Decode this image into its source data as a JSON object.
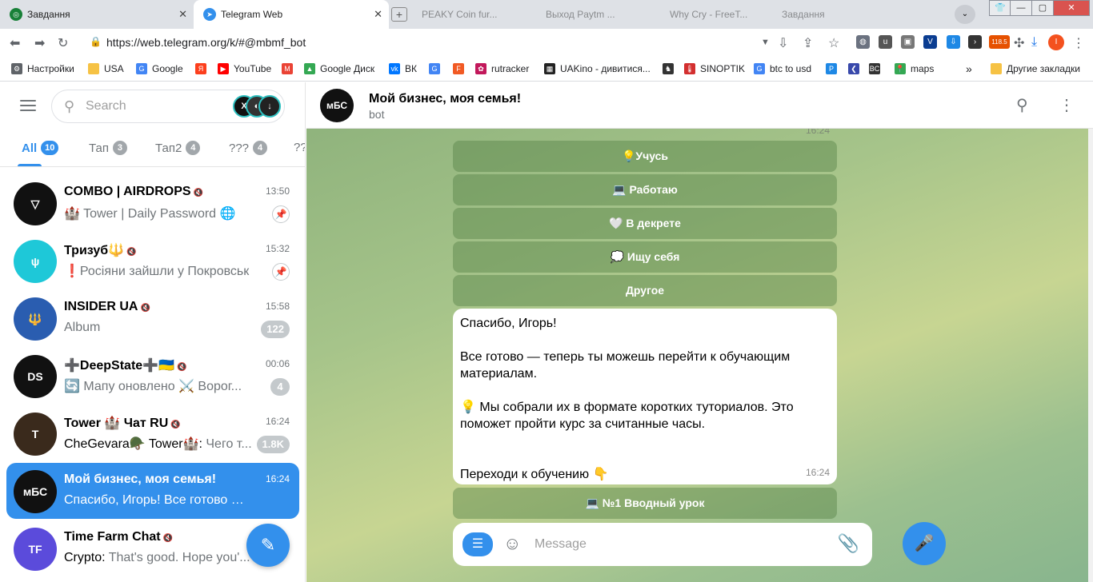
{
  "browser": {
    "tabs": [
      {
        "title": "Завдання",
        "color": "#188038"
      },
      {
        "title": "Telegram Web",
        "color": "#3390ec"
      }
    ],
    "ghost_tabs": [
      "PEAKY Coin fur...",
      "Выход Paytm ...",
      "Why Cry - FreeT...",
      "Завдання"
    ],
    "new_tab": "+",
    "window_controls": {
      "minimize": "—",
      "maximize": "▢",
      "close": "✕"
    },
    "url": "https://web.telegram.org/k/#@mbmf_bot",
    "ext_badge": "118.5",
    "profile_initial": "I",
    "bookmarks": [
      {
        "label": "Настройки",
        "color": "#5f6368",
        "glyph": "⚙"
      },
      {
        "label": "USA",
        "color": "#f6c244",
        "glyph": ""
      },
      {
        "label": "Google",
        "color": "#4285f4",
        "glyph": "G"
      },
      {
        "label": "",
        "color": "#fc3f1d",
        "glyph": "Я"
      },
      {
        "label": "YouTube",
        "color": "#ff0000",
        "glyph": "▶"
      },
      {
        "label": "",
        "color": "#ea4335",
        "glyph": "M"
      },
      {
        "label": "Google Диск",
        "color": "#34a853",
        "glyph": "▲"
      },
      {
        "label": "ВК",
        "color": "#0077ff",
        "glyph": "vk"
      },
      {
        "label": "",
        "color": "#4285f4",
        "glyph": "G"
      },
      {
        "label": "",
        "color": "#f15a24",
        "glyph": "F"
      },
      {
        "label": "rutracker",
        "color": "#c2185b",
        "glyph": "✿"
      },
      {
        "label": "UAKino - дивитися...",
        "color": "#222",
        "glyph": "▦"
      },
      {
        "label": "",
        "color": "#333",
        "glyph": "♞"
      },
      {
        "label": "SINOPTIK",
        "color": "#d32f2f",
        "glyph": "🌡"
      },
      {
        "label": "btc to usd",
        "color": "#4285f4",
        "glyph": "G"
      },
      {
        "label": "",
        "color": "#1e88e5",
        "glyph": "P"
      },
      {
        "label": "",
        "color": "#3949ab",
        "glyph": "❮"
      },
      {
        "label": "",
        "color": "#333",
        "glyph": "BC"
      },
      {
        "label": "maps",
        "color": "#34a853",
        "glyph": "📍"
      }
    ],
    "more": "»",
    "other_bookmarks": "Другие закладки"
  },
  "sidebar": {
    "search_placeholder": "Search",
    "folders": [
      {
        "label": "All",
        "count": "10",
        "active": true
      },
      {
        "label": "Тап",
        "count": "3"
      },
      {
        "label": "Тап2",
        "count": "4"
      },
      {
        "label": "???",
        "count": "4"
      },
      {
        "label": "??",
        "count": ""
      }
    ],
    "chats": [
      {
        "name": "COMBO | AIRDROPS",
        "time": "13:50",
        "sender": "",
        "preview": "🏰 Tower | Daily Password 🌐",
        "badge": "",
        "pinned": true,
        "avatar": "#111111",
        "initials": "▽"
      },
      {
        "name": "Тризуб🔱",
        "time": "15:32",
        "sender": "",
        "preview": "❗Росіяни зайшли у Покровськ",
        "badge": "",
        "pinned": true,
        "avatar": "#1ec8d8",
        "initials": "ψ"
      },
      {
        "name": "INSIDER UA",
        "time": "15:58",
        "sender": "",
        "preview": "Album",
        "badge": "122",
        "pinned": false,
        "avatar": "#2a5db0",
        "initials": "🔱"
      },
      {
        "name": "➕DeepState➕🇺🇦",
        "time": "00:06",
        "sender": "",
        "preview": "🔄 Мапу оновлено ⚔️ Ворог...",
        "badge": "4",
        "pinned": false,
        "avatar": "#111111",
        "initials": "DS"
      },
      {
        "name": "Tower 🏰 Чат RU",
        "time": "16:24",
        "sender": "CheGevara🪖 Tower🏰: ",
        "preview": "Чего т...",
        "badge": "1.8K",
        "pinned": false,
        "avatar": "#3a2a1c",
        "initials": "T"
      },
      {
        "name": "Мой бизнес, моя семья!",
        "time": "16:24",
        "sender": "",
        "preview": "Спасибо, Игорь! Все готово — теперь...",
        "badge": "",
        "pinned": false,
        "avatar": "#111111",
        "initials": "мБС",
        "selected": true
      },
      {
        "name": "Time Farm Chat",
        "time": "",
        "sender": "Crypto: ",
        "preview": "That's good. Hope you'...",
        "badge": "",
        "pinned": false,
        "avatar": "#5b4bdb",
        "initials": "TF"
      }
    ]
  },
  "chat": {
    "title": "Мой бизнес, моя семья!",
    "subtitle": "bot",
    "avatar_text": "мБС",
    "prev_time": "16:24",
    "keyboard": [
      "💡Учусь",
      "💻 Работаю",
      "🤍 В декрете",
      "💭 Ищу себя",
      "Другое"
    ],
    "message": {
      "l1": "Спасибо, Игорь!",
      "l2": "Все готово — теперь ты можешь перейти к обучающим материалам.",
      "l3": "💡 Мы собрали их в формате коротких туториалов. Это поможет пройти курс за считанные часы.",
      "l4": "Переходи к обучению 👇",
      "time": "16:24"
    },
    "inline_button": "💻 №1 Вводный урок",
    "composer_placeholder": "Message"
  }
}
